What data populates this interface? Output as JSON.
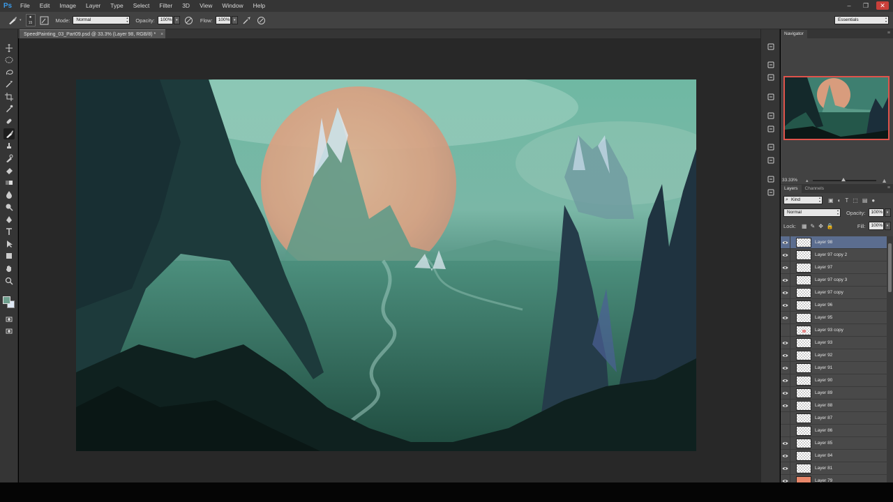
{
  "app": {
    "logo": "Ps"
  },
  "menu": [
    "File",
    "Edit",
    "Image",
    "Layer",
    "Type",
    "Select",
    "Filter",
    "3D",
    "View",
    "Window",
    "Help"
  ],
  "window_controls": {
    "minimize": "–",
    "restore": "❐",
    "close": "✕"
  },
  "options_bar": {
    "brush_size": "15",
    "mode_label": "Mode:",
    "mode_value": "Normal",
    "opacity_label": "Opacity:",
    "opacity_value": "100%",
    "flow_label": "Flow:",
    "flow_value": "100%",
    "workspace": "Essentials"
  },
  "document_tab": {
    "title": "SpeedPainting_03_Part09.psd @ 33.3% (Layer 98, RGB/8) *",
    "close": "×"
  },
  "navigator": {
    "tab": "Navigator",
    "zoom": "33.33%"
  },
  "layers_panel": {
    "tabs": [
      "Layers",
      "Channels"
    ],
    "filter_kind": "Kind",
    "blend_mode": "Normal",
    "opacity_label": "Opacity:",
    "opacity_value": "100%",
    "lock_label": "Lock:",
    "fill_label": "Fill:",
    "fill_value": "100%",
    "layers": [
      {
        "name": "Layer 98",
        "visible": true,
        "selected": true,
        "thumb": "transparent"
      },
      {
        "name": "Layer 97 copy 2",
        "visible": true,
        "selected": false,
        "thumb": "transparent"
      },
      {
        "name": "Layer 97",
        "visible": true,
        "selected": false,
        "thumb": "transparent"
      },
      {
        "name": "Layer 97 copy 3",
        "visible": true,
        "selected": false,
        "thumb": "transparent"
      },
      {
        "name": "Layer 97 copy",
        "visible": true,
        "selected": false,
        "thumb": "transparent"
      },
      {
        "name": "Layer 96",
        "visible": true,
        "selected": false,
        "thumb": "transparent"
      },
      {
        "name": "Layer 95",
        "visible": true,
        "selected": false,
        "thumb": "transparent"
      },
      {
        "name": "Layer 93 copy",
        "visible": false,
        "selected": false,
        "thumb": "marked"
      },
      {
        "name": "Layer 93",
        "visible": true,
        "selected": false,
        "thumb": "transparent"
      },
      {
        "name": "Layer 92",
        "visible": true,
        "selected": false,
        "thumb": "transparent"
      },
      {
        "name": "Layer 91",
        "visible": true,
        "selected": false,
        "thumb": "transparent"
      },
      {
        "name": "Layer 90",
        "visible": true,
        "selected": false,
        "thumb": "transparent"
      },
      {
        "name": "Layer 89",
        "visible": true,
        "selected": false,
        "thumb": "transparent"
      },
      {
        "name": "Layer 88",
        "visible": true,
        "selected": false,
        "thumb": "transparent"
      },
      {
        "name": "Layer 87",
        "visible": false,
        "selected": false,
        "thumb": "transparent"
      },
      {
        "name": "Layer 86",
        "visible": false,
        "selected": false,
        "thumb": "transparent"
      },
      {
        "name": "Layer 85",
        "visible": true,
        "selected": false,
        "thumb": "transparent"
      },
      {
        "name": "Layer 84",
        "visible": true,
        "selected": false,
        "thumb": "transparent"
      },
      {
        "name": "Layer 81",
        "visible": true,
        "selected": false,
        "thumb": "transparent"
      },
      {
        "name": "Layer 79",
        "visible": true,
        "selected": false,
        "thumb": "orange"
      }
    ]
  },
  "colors": {
    "foreground": "#6e9f8e",
    "background": "#dfe8f5",
    "selection": "#5b6d8f",
    "navigator_frame": "#e0534b"
  },
  "tools": [
    "move-icon",
    "marquee-icon",
    "lasso-icon",
    "magic-wand-icon",
    "crop-icon",
    "eyedropper-icon",
    "healing-brush-icon",
    "brush-icon",
    "clone-stamp-icon",
    "history-brush-icon",
    "eraser-icon",
    "gradient-icon",
    "blur-icon",
    "dodge-icon",
    "pen-icon",
    "type-icon",
    "path-selection-icon",
    "shape-icon",
    "hand-icon",
    "zoom-icon"
  ]
}
